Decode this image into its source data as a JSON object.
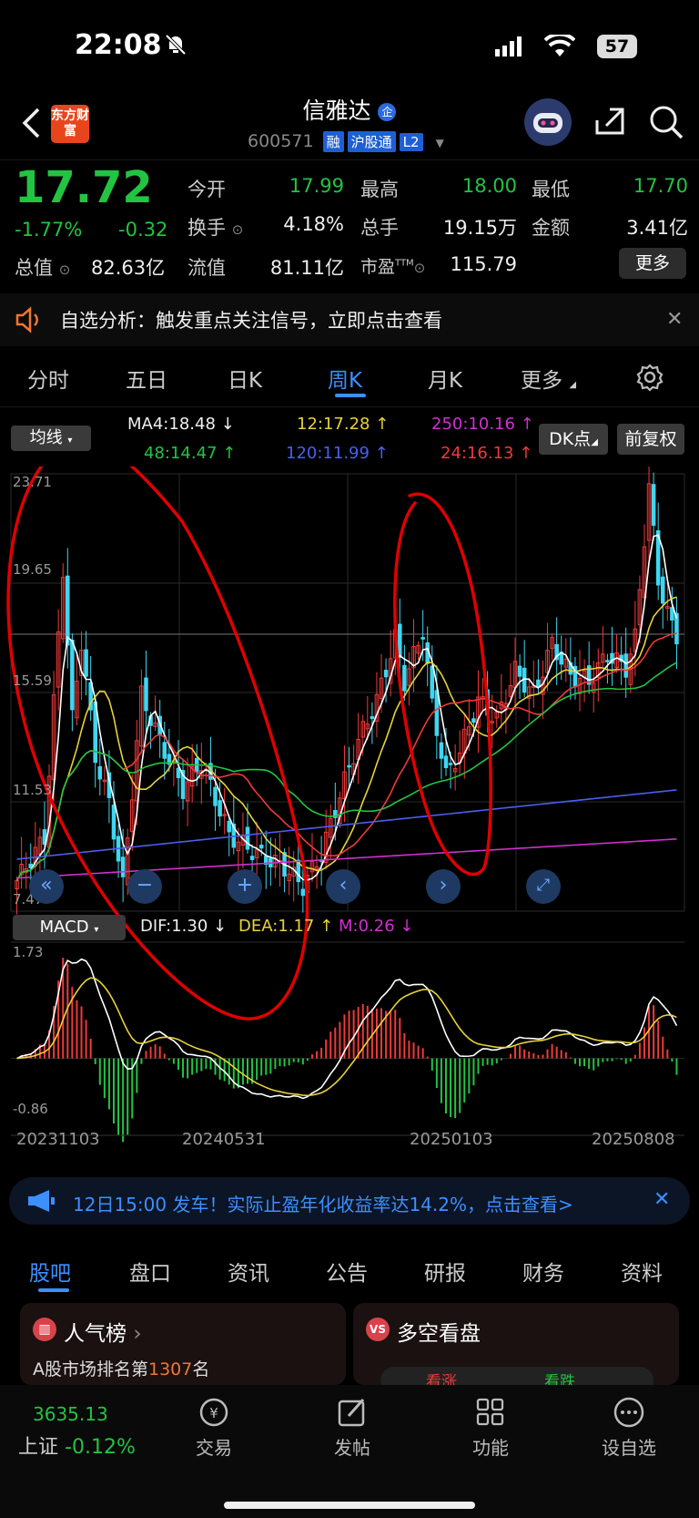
{
  "status_bar": {
    "time": "22:08",
    "battery": "57"
  },
  "header": {
    "app_logo_text": "东方财富",
    "title": "信雅达",
    "code": "600571",
    "tags": [
      "融",
      "沪股通",
      "L2"
    ]
  },
  "quote": {
    "price": "17.72",
    "change_pct": "-1.77%",
    "change": "-0.32",
    "fields": {
      "open": {
        "label": "今开",
        "value": "17.99"
      },
      "high": {
        "label": "最高",
        "value": "18.00"
      },
      "low": {
        "label": "最低",
        "value": "17.70"
      },
      "turnover": {
        "label": "换手",
        "value": "4.18%"
      },
      "volume": {
        "label": "总手",
        "value": "19.15万"
      },
      "amount": {
        "label": "金额",
        "value": "3.41亿"
      },
      "total_value": {
        "label": "总值",
        "value": "82.63亿"
      },
      "float_value": {
        "label": "流值",
        "value": "81.11亿"
      },
      "pe": {
        "label": "市盈",
        "sup": "TTM",
        "value": "115.79"
      }
    },
    "more_label": "更多"
  },
  "alert": {
    "text": "自选分析：触发重点关注信号，立即点击查看"
  },
  "chart_tabs": [
    "分时",
    "五日",
    "日K",
    "周K",
    "月K",
    "更多"
  ],
  "active_tab": "周K",
  "ma_bar": {
    "selector": "均线",
    "ma4": "MA4:18.48",
    "ma12": "12:17.28",
    "ma250": "250:10.16",
    "ma48": "48:14.47",
    "ma120": "120:11.99",
    "ma24": "24:16.13",
    "dk_button": "DK点",
    "adjust_button": "前复权"
  },
  "price_axis": [
    "23.71",
    "19.65",
    "15.59",
    "11.53",
    "7.47"
  ],
  "macd_bar": {
    "selector": "MACD",
    "dif": "DIF:1.30",
    "dea": "DEA:1.17",
    "m": "M:0.26"
  },
  "macd_axis": {
    "top": "1.73",
    "bottom": "-0.86"
  },
  "date_axis": [
    "20231103",
    "20240531",
    "20250103",
    "20250808"
  ],
  "chart_data": {
    "type": "candlestick",
    "x_range": [
      "20231103",
      "20250808"
    ],
    "y_range": [
      7.47,
      23.71
    ],
    "last_close": 17.72,
    "moving_averages": {
      "MA4": 18.48,
      "MA12": 17.28,
      "MA24": 16.13,
      "MA48": 14.47,
      "MA120": 11.99,
      "MA250": 10.16
    },
    "macd": {
      "DIF": 1.3,
      "DEA": 1.17,
      "M": 0.26,
      "y_range": [
        -0.86,
        1.73
      ]
    }
  },
  "banner": {
    "text": "12日15:00 发车！实际止盈年化收益率达14.2%，点击查看>"
  },
  "bottom_tabs": [
    "股吧",
    "盘口",
    "资讯",
    "公告",
    "研报",
    "财务",
    "资料"
  ],
  "active_bottom_tab": "股吧",
  "cards": {
    "popularity": {
      "title": "人气榜",
      "rank_prefix": "A股市场排名第",
      "rank": "1307",
      "rank_suffix": "名"
    },
    "bull_bear": {
      "title": "多空看盘",
      "bull": "看涨",
      "bear": "看跌"
    }
  },
  "bottom_nav": {
    "index_value": "3635.13",
    "index_name": "上证",
    "index_change": "-0.12%",
    "items": [
      "交易",
      "发帖",
      "功能",
      "设自选"
    ]
  },
  "colors": {
    "up": "#ef3a3a",
    "down": "#22c442",
    "accent": "#3d8fff",
    "annotation": "#e00000"
  }
}
